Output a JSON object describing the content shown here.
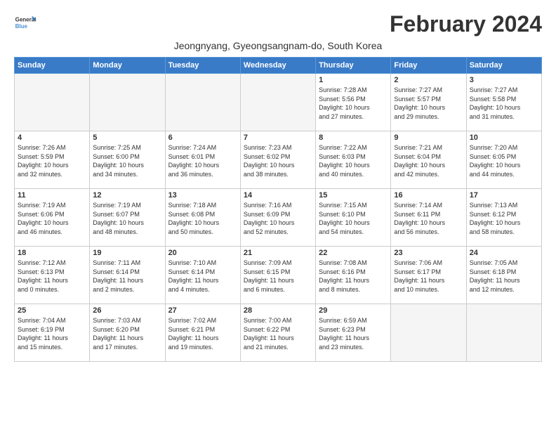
{
  "logo": {
    "line1": "General",
    "line2": "Blue"
  },
  "title": "February 2024",
  "subtitle": "Jeongnyang, Gyeongsangnam-do, South Korea",
  "headers": [
    "Sunday",
    "Monday",
    "Tuesday",
    "Wednesday",
    "Thursday",
    "Friday",
    "Saturday"
  ],
  "weeks": [
    [
      {
        "day": "",
        "info": "",
        "empty": true
      },
      {
        "day": "",
        "info": "",
        "empty": true
      },
      {
        "day": "",
        "info": "",
        "empty": true
      },
      {
        "day": "",
        "info": "",
        "empty": true
      },
      {
        "day": "1",
        "info": "Sunrise: 7:28 AM\nSunset: 5:56 PM\nDaylight: 10 hours\nand 27 minutes."
      },
      {
        "day": "2",
        "info": "Sunrise: 7:27 AM\nSunset: 5:57 PM\nDaylight: 10 hours\nand 29 minutes."
      },
      {
        "day": "3",
        "info": "Sunrise: 7:27 AM\nSunset: 5:58 PM\nDaylight: 10 hours\nand 31 minutes."
      }
    ],
    [
      {
        "day": "4",
        "info": "Sunrise: 7:26 AM\nSunset: 5:59 PM\nDaylight: 10 hours\nand 32 minutes."
      },
      {
        "day": "5",
        "info": "Sunrise: 7:25 AM\nSunset: 6:00 PM\nDaylight: 10 hours\nand 34 minutes."
      },
      {
        "day": "6",
        "info": "Sunrise: 7:24 AM\nSunset: 6:01 PM\nDaylight: 10 hours\nand 36 minutes."
      },
      {
        "day": "7",
        "info": "Sunrise: 7:23 AM\nSunset: 6:02 PM\nDaylight: 10 hours\nand 38 minutes."
      },
      {
        "day": "8",
        "info": "Sunrise: 7:22 AM\nSunset: 6:03 PM\nDaylight: 10 hours\nand 40 minutes."
      },
      {
        "day": "9",
        "info": "Sunrise: 7:21 AM\nSunset: 6:04 PM\nDaylight: 10 hours\nand 42 minutes."
      },
      {
        "day": "10",
        "info": "Sunrise: 7:20 AM\nSunset: 6:05 PM\nDaylight: 10 hours\nand 44 minutes."
      }
    ],
    [
      {
        "day": "11",
        "info": "Sunrise: 7:19 AM\nSunset: 6:06 PM\nDaylight: 10 hours\nand 46 minutes."
      },
      {
        "day": "12",
        "info": "Sunrise: 7:19 AM\nSunset: 6:07 PM\nDaylight: 10 hours\nand 48 minutes."
      },
      {
        "day": "13",
        "info": "Sunrise: 7:18 AM\nSunset: 6:08 PM\nDaylight: 10 hours\nand 50 minutes."
      },
      {
        "day": "14",
        "info": "Sunrise: 7:16 AM\nSunset: 6:09 PM\nDaylight: 10 hours\nand 52 minutes."
      },
      {
        "day": "15",
        "info": "Sunrise: 7:15 AM\nSunset: 6:10 PM\nDaylight: 10 hours\nand 54 minutes."
      },
      {
        "day": "16",
        "info": "Sunrise: 7:14 AM\nSunset: 6:11 PM\nDaylight: 10 hours\nand 56 minutes."
      },
      {
        "day": "17",
        "info": "Sunrise: 7:13 AM\nSunset: 6:12 PM\nDaylight: 10 hours\nand 58 minutes."
      }
    ],
    [
      {
        "day": "18",
        "info": "Sunrise: 7:12 AM\nSunset: 6:13 PM\nDaylight: 11 hours\nand 0 minutes."
      },
      {
        "day": "19",
        "info": "Sunrise: 7:11 AM\nSunset: 6:14 PM\nDaylight: 11 hours\nand 2 minutes."
      },
      {
        "day": "20",
        "info": "Sunrise: 7:10 AM\nSunset: 6:14 PM\nDaylight: 11 hours\nand 4 minutes."
      },
      {
        "day": "21",
        "info": "Sunrise: 7:09 AM\nSunset: 6:15 PM\nDaylight: 11 hours\nand 6 minutes."
      },
      {
        "day": "22",
        "info": "Sunrise: 7:08 AM\nSunset: 6:16 PM\nDaylight: 11 hours\nand 8 minutes."
      },
      {
        "day": "23",
        "info": "Sunrise: 7:06 AM\nSunset: 6:17 PM\nDaylight: 11 hours\nand 10 minutes."
      },
      {
        "day": "24",
        "info": "Sunrise: 7:05 AM\nSunset: 6:18 PM\nDaylight: 11 hours\nand 12 minutes."
      }
    ],
    [
      {
        "day": "25",
        "info": "Sunrise: 7:04 AM\nSunset: 6:19 PM\nDaylight: 11 hours\nand 15 minutes."
      },
      {
        "day": "26",
        "info": "Sunrise: 7:03 AM\nSunset: 6:20 PM\nDaylight: 11 hours\nand 17 minutes."
      },
      {
        "day": "27",
        "info": "Sunrise: 7:02 AM\nSunset: 6:21 PM\nDaylight: 11 hours\nand 19 minutes."
      },
      {
        "day": "28",
        "info": "Sunrise: 7:00 AM\nSunset: 6:22 PM\nDaylight: 11 hours\nand 21 minutes."
      },
      {
        "day": "29",
        "info": "Sunrise: 6:59 AM\nSunset: 6:23 PM\nDaylight: 11 hours\nand 23 minutes."
      },
      {
        "day": "",
        "info": "",
        "empty": true
      },
      {
        "day": "",
        "info": "",
        "empty": true
      }
    ]
  ]
}
